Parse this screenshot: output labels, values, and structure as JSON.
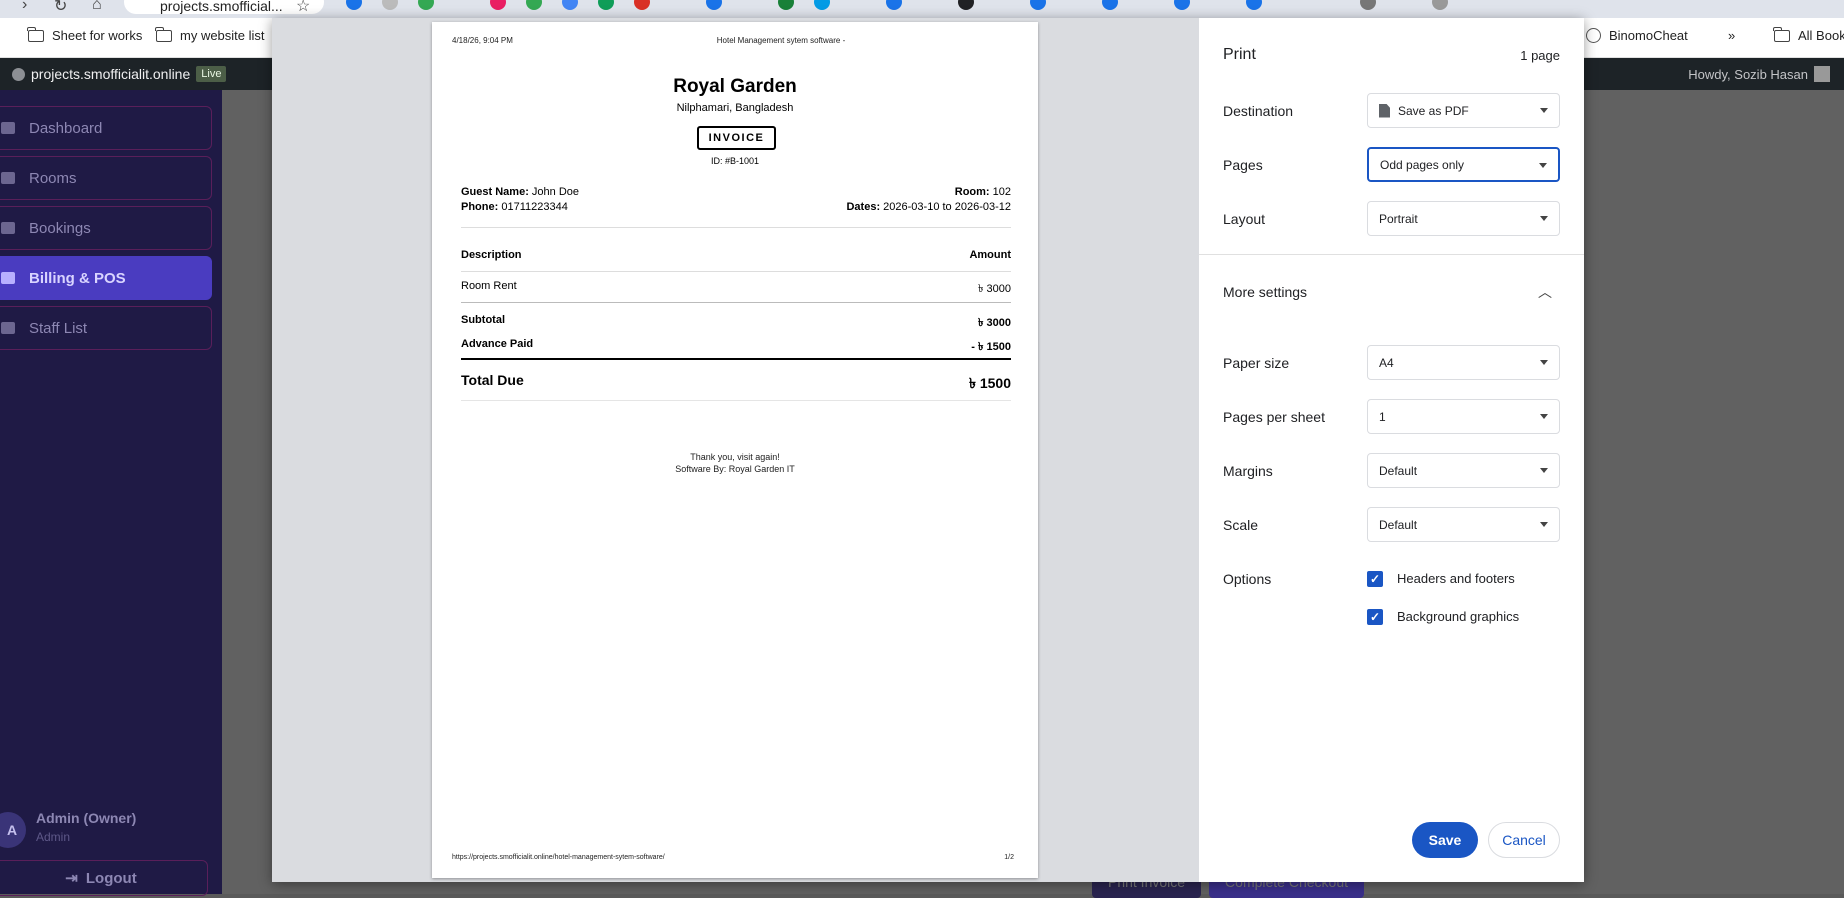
{
  "browser": {
    "omnibox_text": "projects.smofficial...",
    "bookmarks": [
      "Sheet for works",
      "my website list",
      "BinomoCheat",
      "All Bookm"
    ],
    "more_bookmarks": "»"
  },
  "admin_bar": {
    "site": "projects.smofficialit.online",
    "live_badge": "Live",
    "howdy": "Howdy, Sozib Hasan"
  },
  "app": {
    "nav": [
      {
        "label": "Dashboard",
        "icon": "dashboard-icon"
      },
      {
        "label": "Rooms",
        "icon": "bed-icon"
      },
      {
        "label": "Bookings",
        "icon": "calendar-icon"
      },
      {
        "label": "Billing & POS",
        "icon": "credit-card-icon",
        "active": true
      },
      {
        "label": "Staff List",
        "icon": "users-icon"
      }
    ],
    "user": {
      "initial": "A",
      "name": "Admin (Owner)",
      "role": "Admin"
    },
    "logout_label": "Logout",
    "behind_buttons": [
      "Print Invoice",
      "Complete Checkout"
    ]
  },
  "print_preview": {
    "header_left": "4/18/26, 9:04 PM",
    "header_center": "Hotel Management sytem software -",
    "footer_left": "https://projects.smofficialit.online/hotel-management-sytem-software/",
    "footer_right": "1/2",
    "invoice": {
      "hotel_name": "Royal Garden",
      "location": "Nilphamari, Bangladesh",
      "badge": "INVOICE",
      "id_line": "ID: #B-1001",
      "guest_label": "Guest Name:",
      "guest_name": "John Doe",
      "phone_label": "Phone:",
      "phone": "01711223344",
      "room_label": "Room:",
      "room": "102",
      "dates_label": "Dates:",
      "dates": "2026-03-10 to 2026-03-12",
      "col_description": "Description",
      "col_amount": "Amount",
      "items": [
        {
          "description": "Room Rent",
          "amount": "৳ 3000"
        }
      ],
      "subtotal_label": "Subtotal",
      "subtotal": "৳ 3000",
      "advance_label": "Advance Paid",
      "advance": "- ৳ 1500",
      "total_label": "Total Due",
      "total": "৳ 1500",
      "thanks": "Thank you, visit again!",
      "software_by": "Software By: Royal Garden IT"
    }
  },
  "print_settings": {
    "title": "Print",
    "page_count": "1 page",
    "destination_label": "Destination",
    "destination_value": "Save as PDF",
    "pages_label": "Pages",
    "pages_value": "Odd pages only",
    "layout_label": "Layout",
    "layout_value": "Portrait",
    "more_settings_label": "More settings",
    "paper_size_label": "Paper size",
    "paper_size_value": "A4",
    "pages_per_sheet_label": "Pages per sheet",
    "pages_per_sheet_value": "1",
    "margins_label": "Margins",
    "margins_value": "Default",
    "scale_label": "Scale",
    "scale_value": "Default",
    "options_label": "Options",
    "option_headers_footers": "Headers and footers",
    "option_headers_footers_checked": true,
    "option_background_graphics": "Background graphics",
    "option_background_graphics_checked": true,
    "save_label": "Save",
    "cancel_label": "Cancel",
    "accent_color": "#1a56c4"
  }
}
